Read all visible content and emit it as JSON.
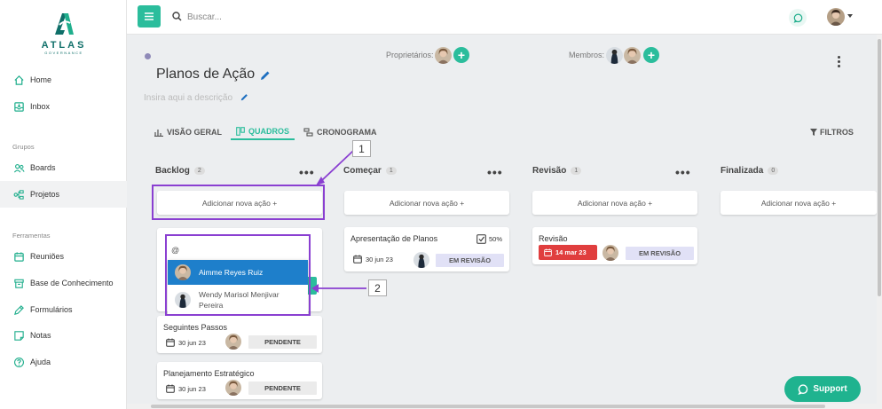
{
  "brand": {
    "name": "ATLAS",
    "sub": "GOVERNANCE",
    "color": "#0f6f69"
  },
  "accent": "#2bbd9c",
  "sidebar": {
    "items": [
      {
        "label": "Home",
        "icon": "home-icon"
      },
      {
        "label": "Inbox",
        "icon": "inbox-icon"
      }
    ],
    "group_label": "Grupos",
    "group_items": [
      {
        "label": "Boards",
        "icon": "users-icon"
      },
      {
        "label": "Projetos",
        "icon": "projects-icon"
      }
    ],
    "tools_label": "Ferramentas",
    "tools_items": [
      {
        "label": "Reuniões",
        "icon": "calendar-icon"
      },
      {
        "label": "Base de Conhecimento",
        "icon": "box-icon"
      },
      {
        "label": "Formulários",
        "icon": "pen-icon"
      },
      {
        "label": "Notas",
        "icon": "note-icon"
      },
      {
        "label": "Ajuda",
        "icon": "help-icon"
      }
    ]
  },
  "search": {
    "placeholder": "Buscar..."
  },
  "page": {
    "title": "Planos de Ação",
    "description_placeholder": "Insira aqui a descrição",
    "owners_label": "Proprietários:",
    "members_label": "Membros:"
  },
  "tabs": [
    {
      "label": "VISÃO GERAL"
    },
    {
      "label": "QUADROS",
      "active": true
    },
    {
      "label": "CRONOGRAMA"
    }
  ],
  "filters_label": "FILTROS",
  "columns": [
    {
      "name": "Backlog",
      "count": "2",
      "add_label": "Adicionar nova ação +"
    },
    {
      "name": "Começar",
      "count": "1",
      "add_label": "Adicionar nova ação +"
    },
    {
      "name": "Revisão",
      "count": "1",
      "add_label": "Adicionar nova ação +"
    },
    {
      "name": "Finalizada",
      "count": "0",
      "add_label": "Adicionar nova ação +"
    }
  ],
  "mention": {
    "query": "@",
    "options": [
      "Aimme Reyes Ruiz",
      "Wendy Marisol Menjivar Pereira"
    ]
  },
  "cards": {
    "backlog": [
      {
        "title": "Seguintes Passos",
        "date": "30 jun 23",
        "status": "PENDENTE"
      },
      {
        "title": "Planejamento Estratégico",
        "date": "30 jun 23",
        "status": "PENDENTE"
      }
    ],
    "comecar": {
      "title": "Apresentação de Planos",
      "progress": "50%",
      "date": "30 jun 23",
      "status": "EM REVISÃO"
    },
    "revisao": {
      "title": "Revisão",
      "date": "14 mar 23",
      "status": "EM REVISÃO",
      "date_color": "#e03e3e"
    }
  },
  "annotations": [
    "1",
    "2"
  ],
  "support_label": "Support"
}
